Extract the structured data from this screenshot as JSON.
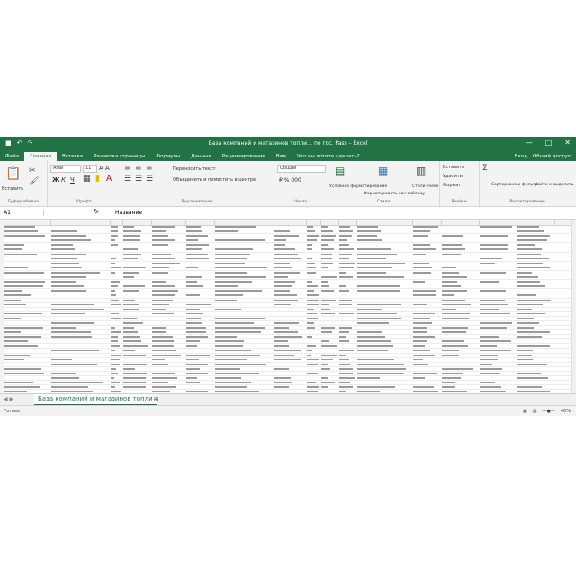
{
  "titlebar": {
    "title": "База компаний и магазинов топли… по гос. Pass – Excel",
    "qat_save": "■",
    "qat_undo": "↶",
    "qat_redo": "↷",
    "win_min": "—",
    "win_max": "□",
    "win_close": "✕"
  },
  "tabs": [
    "Файл",
    "Главная",
    "Вставка",
    "Разметка страницы",
    "Формулы",
    "Данные",
    "Рецензирование",
    "Вид"
  ],
  "active_tab": "Главная",
  "tell_me": "Что вы хотите сделать?",
  "signin": "Вход",
  "share": "Общий доступ",
  "ribbon": {
    "clipboard": {
      "paste": "Вставить",
      "label": "Буфер обмена"
    },
    "font": {
      "name": "Arial",
      "size": "11",
      "bold": "Ж",
      "italic": "К",
      "underline": "Ч",
      "label": "Шрифт"
    },
    "alignment": {
      "wrap": "Переносить текст",
      "merge": "Объединить и поместить в центре",
      "label": "Выравнивание"
    },
    "number": {
      "format": "Общий",
      "label": "Число"
    },
    "styles": {
      "conditional": "Условное форматирование",
      "as_table": "Форматировать как таблицу",
      "cell_styles": "Стили ячеек",
      "label": "Стили"
    },
    "cells": {
      "insert": "Вставить",
      "delete": "Удалить",
      "format": "Формат",
      "label": "Ячейки"
    },
    "editing": {
      "sort": "Сортировка и фильтр",
      "find": "Найти и выделить",
      "label": "Редактирование"
    }
  },
  "formula_bar": {
    "cell_ref": "A1",
    "fx": "fx",
    "value": "Название"
  },
  "sheet_tab": "База компаний и магазинов топли",
  "status": {
    "ready": "Готово",
    "zoom": "40%"
  }
}
